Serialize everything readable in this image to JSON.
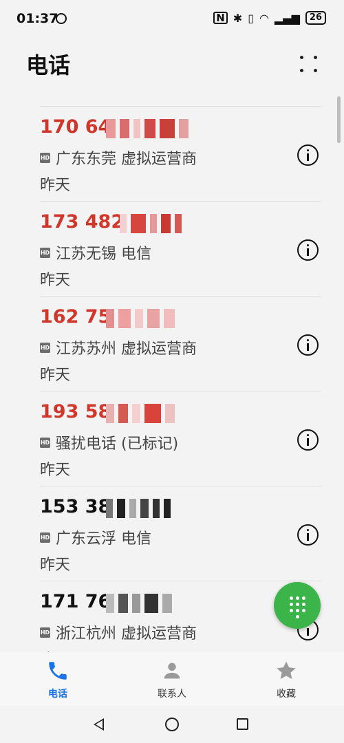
{
  "status_bar": {
    "time": "01:37",
    "battery": "26"
  },
  "header": {
    "title": "电话"
  },
  "call_log": [
    {
      "number": "170 64",
      "location": "广东东莞 虚拟运营商",
      "date": "昨天",
      "missed": true
    },
    {
      "number": "173 482",
      "location": "江苏无锡 电信",
      "date": "昨天",
      "missed": true
    },
    {
      "number": "162 75",
      "location": "江苏苏州 虚拟运营商",
      "date": "昨天",
      "missed": true
    },
    {
      "number": "193 58",
      "location": "骚扰电话 (已标记)",
      "date": "昨天",
      "missed": true
    },
    {
      "number": "153 38",
      "location": "广东云浮 电信",
      "date": "昨天",
      "missed": false
    },
    {
      "number": "171 76",
      "location": "浙江杭州 虚拟运营商",
      "date": "昨天",
      "missed": false
    }
  ],
  "bottom_nav": [
    {
      "label": "电话",
      "icon": "phone-icon",
      "active": true
    },
    {
      "label": "联系人",
      "icon": "person-icon",
      "active": false
    },
    {
      "label": "收藏",
      "icon": "star-icon",
      "active": false
    }
  ],
  "colors": {
    "missed": "#d0362a",
    "accent": "#1a73e8",
    "fab": "#3bb44a"
  }
}
